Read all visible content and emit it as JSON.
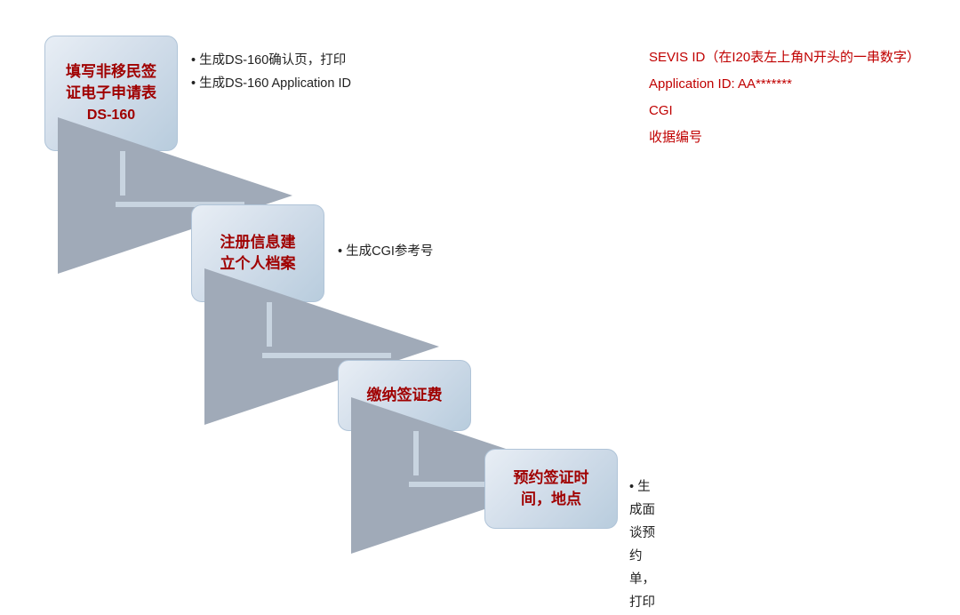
{
  "steps": [
    {
      "id": "step1",
      "label_line1": "填写非移民签",
      "label_line2": "证电子申请表",
      "label_line3": "DS-160",
      "desc_lines": [
        "• 生成DS-160确认页，打印",
        "• 生成DS-160 Application ID"
      ]
    },
    {
      "id": "step2",
      "label_line1": "注册信息建",
      "label_line2": "立个人档案",
      "desc_lines": [
        "• 生成CGI参考号"
      ]
    },
    {
      "id": "step3",
      "label_line1": "缴纳签证费",
      "desc_lines": []
    },
    {
      "id": "step4",
      "label_line1": "预约签证时",
      "label_line2": "间，地点",
      "desc_lines": [
        "• 生成面谈预约单，打印"
      ]
    }
  ],
  "info": {
    "line1": "SEVIS ID（在I20表左上角N开头的一串数字）",
    "line2": "Application ID: AA*******",
    "line3": "CGI",
    "line4": "收据编号"
  }
}
